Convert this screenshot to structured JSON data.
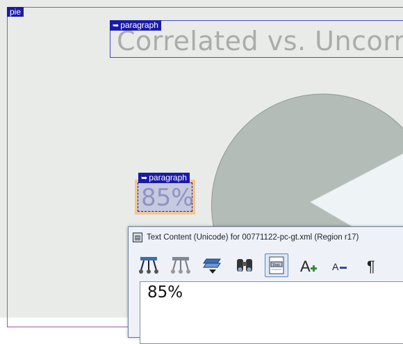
{
  "regions": {
    "pie_tag": "pie",
    "title_tag": "paragraph",
    "title_text": "Correlated vs. Uncorr",
    "percent_tag": "paragraph",
    "percent_text": "85%"
  },
  "dialog": {
    "title": "Text Content (Unicode) for 00771122-pc-gt.xml  (Region r17)",
    "app_icon": "page-icon",
    "toolbar": [
      {
        "name": "tree-up-icon"
      },
      {
        "name": "tree-down-icon"
      },
      {
        "name": "layers-icon"
      },
      {
        "name": "binoculars-icon"
      },
      {
        "name": "text-doc-icon",
        "label": "Text"
      },
      {
        "name": "increase-font-icon",
        "label": "A"
      },
      {
        "name": "decrease-font-icon",
        "label": "A"
      },
      {
        "name": "pilcrow-icon",
        "label": "¶"
      }
    ],
    "content": "85%"
  },
  "colors": {
    "region_border": "#9a58a8",
    "tag_bg": "#1a1aa8",
    "paragraph_border": "#4b48c8",
    "selected_fill": "#f0c595",
    "pie_gray": "#b3bcb6",
    "pie_light": "#eef4f6"
  }
}
